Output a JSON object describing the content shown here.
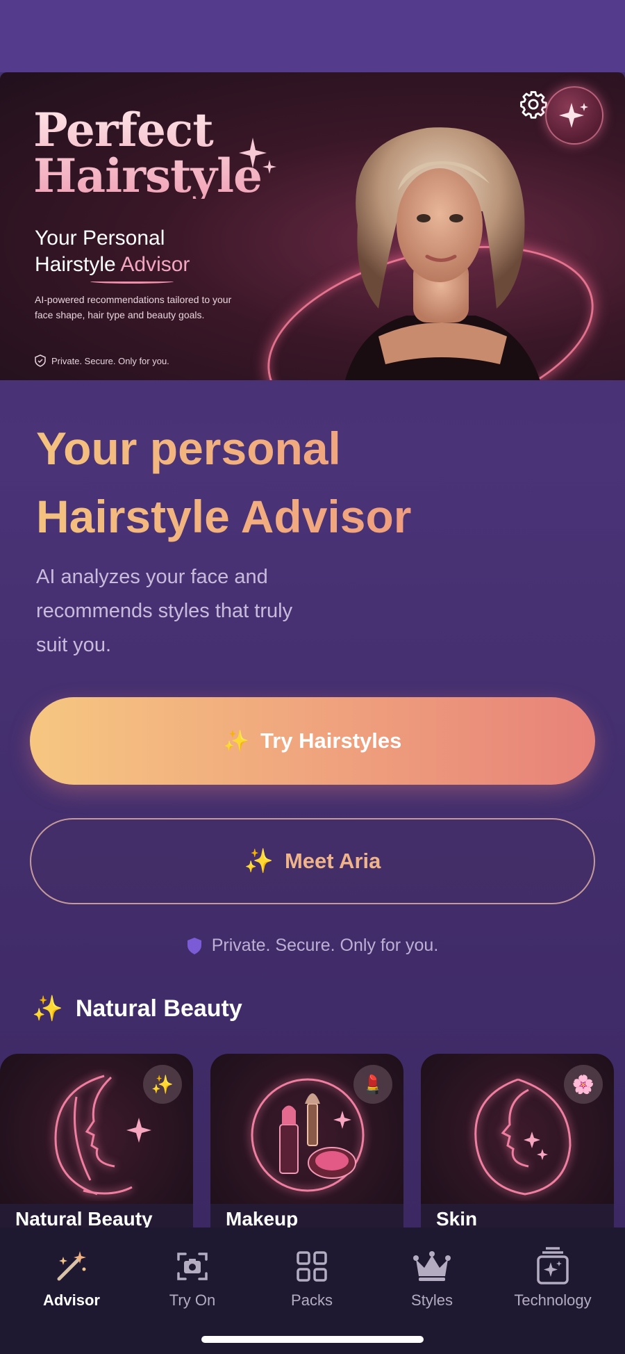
{
  "hero": {
    "title_line1": "Perfect",
    "title_line2": "Hairstyle",
    "subtitle_line1": "Your Personal",
    "subtitle_line2_a": "Hairstyle ",
    "subtitle_line2_b": "Advisor",
    "description": "AI-powered recommendations tailored to your face shape, hair type and beauty goals.",
    "private_text": "Private. Secure. Only for you."
  },
  "main": {
    "headline_line1": "Your personal",
    "headline_line2": "Hairstyle Advisor",
    "subtext": "AI analyzes your face and recommends styles that truly suit you.",
    "primary_button": "Try Hairstyles",
    "secondary_button": "Meet Aria",
    "private_text": "Private. Secure. Only for you."
  },
  "section": {
    "title": "Natural Beauty",
    "cards": [
      {
        "label": "Natural Beauty",
        "badge_icon": "sparkles-icon"
      },
      {
        "label": "Makeup",
        "badge_icon": "lipstick-icon"
      },
      {
        "label": "Skin",
        "badge_icon": "blossom-icon"
      }
    ]
  },
  "tabs": [
    {
      "label": "Advisor",
      "icon": "magic-wand-icon",
      "active": true
    },
    {
      "label": "Try On",
      "icon": "camera-frame-icon",
      "active": false
    },
    {
      "label": "Packs",
      "icon": "grid-icon",
      "active": false
    },
    {
      "label": "Styles",
      "icon": "crown-icon",
      "active": false
    },
    {
      "label": "Technology",
      "icon": "sparkle-stack-icon",
      "active": false
    }
  ],
  "colors": {
    "background": "#4a3275",
    "accent_gradient_start": "#f6c781",
    "accent_gradient_end": "#e78279",
    "tabbar": "#1e1830"
  }
}
